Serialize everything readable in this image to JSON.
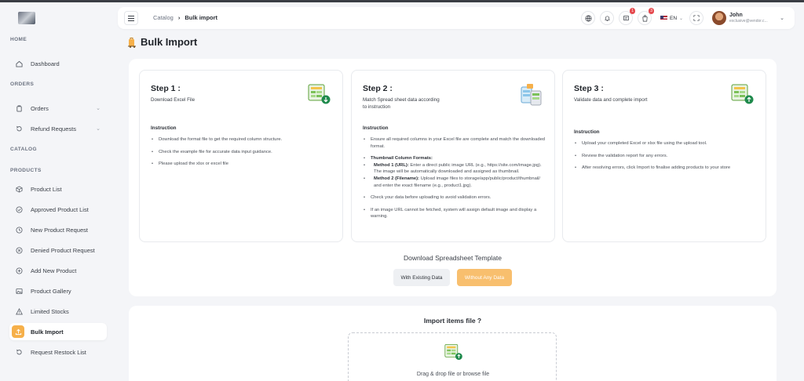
{
  "header": {
    "breadcrumb": [
      "Catalog",
      "Bulk import"
    ],
    "badges": {
      "messages": "1",
      "orders": "3"
    },
    "language": "EN",
    "user": {
      "name": "John",
      "email": "exclusive@vendor.c..."
    }
  },
  "sidebar": {
    "sections": [
      "HOME",
      "ORDERS",
      "CATALOG",
      "PRODUCTS"
    ],
    "items": [
      {
        "label": "Dashboard",
        "icon": "home-icon"
      },
      {
        "label": "Orders",
        "icon": "orders-icon"
      },
      {
        "label": "Refund Requests",
        "icon": "refund-icon"
      },
      {
        "label": "Product List",
        "icon": "box-icon"
      },
      {
        "label": "Approved Product List",
        "icon": "check-circle-icon"
      },
      {
        "label": "New Product Request",
        "icon": "clock-icon"
      },
      {
        "label": "Denied Product Request",
        "icon": "x-circle-icon"
      },
      {
        "label": "Add New Product",
        "icon": "plus-circle-icon"
      },
      {
        "label": "Product Gallery",
        "icon": "image-icon"
      },
      {
        "label": "Limited Stocks",
        "icon": "warning-icon"
      },
      {
        "label": "Bulk Import",
        "icon": "upload-icon"
      },
      {
        "label": "Request Restock List",
        "icon": "restock-icon"
      }
    ]
  },
  "page": {
    "title": "Bulk Import"
  },
  "steps": [
    {
      "title": "Step 1 :",
      "subtitle": "Download Excel File",
      "instruction_label": "Instruction",
      "bullets": [
        "Download the format file to get the required column structure.",
        "Check the example file for accurate data input guidance.",
        "Please upload the xlsx or excel file"
      ]
    },
    {
      "title": "Step 2 :",
      "subtitle": "Match Spread sheet data according to instruction",
      "instruction_label": "Instruction",
      "bullets": [
        "Ensure all required columns in your Excel file are complete and match the downloaded format.",
        "Thumbnail Column Formats:",
        "Method 1 (URL):",
        "Enter a direct public image URL (e.g., https://site.com/image.jpg). The image will be automatically downloaded and assigned as thumbnail.",
        "Method 2 (Filename):",
        "Upload image files to storage/app/public/product/thumbnail/ and enter the exact filename (e.g., product1.jpg).",
        "Check your data before uploading to avoid validation errors.",
        "If an image URL cannot be fetched, system will assign default image and display a warning."
      ]
    },
    {
      "title": "Step 3 :",
      "subtitle": "Validate data and complete import",
      "instruction_label": "Instruction",
      "bullets": [
        "Upload your completed Excel or xlsx file using the upload tool.",
        "Review the validation report for any errors.",
        "After resolving errors, click Import to finalise adding products to your store"
      ]
    }
  ],
  "download": {
    "title": "Download Spreadsheet Template",
    "with_data": "With Existing Data",
    "without_data": "Without Any Data"
  },
  "import": {
    "title": "Import items file ?",
    "dropzone": "Drag & drop file or browse file"
  },
  "colors": {
    "accent": "#f6b04a",
    "accent_light": "#f8bf6e",
    "badge": "#e5484d"
  }
}
